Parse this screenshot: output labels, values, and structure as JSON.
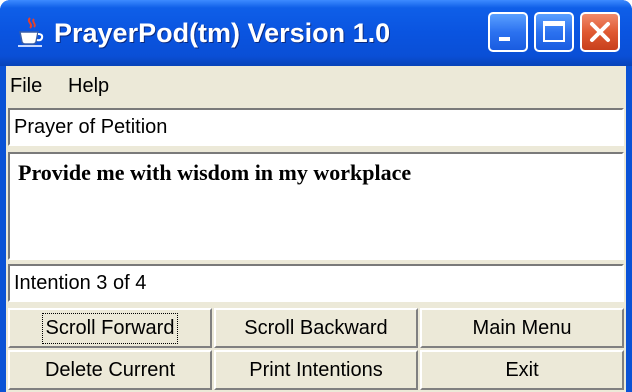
{
  "window": {
    "title": "PrayerPod(tm) Version 1.0",
    "titlebar_color": "#0a54e0",
    "close_color": "#e05a32"
  },
  "menu": {
    "items": [
      {
        "label": "File"
      },
      {
        "label": "Help"
      }
    ]
  },
  "category": {
    "value": "Prayer of Petition"
  },
  "intention": {
    "text": "Provide me with wisdom in my workplace"
  },
  "status": {
    "value": "Intention 3 of 4"
  },
  "buttons": {
    "scroll_forward": "Scroll Forward",
    "scroll_backward": "Scroll Backward",
    "main_menu": "Main Menu",
    "delete_current": "Delete Current",
    "print_intentions": "Print Intentions",
    "exit": "Exit"
  }
}
